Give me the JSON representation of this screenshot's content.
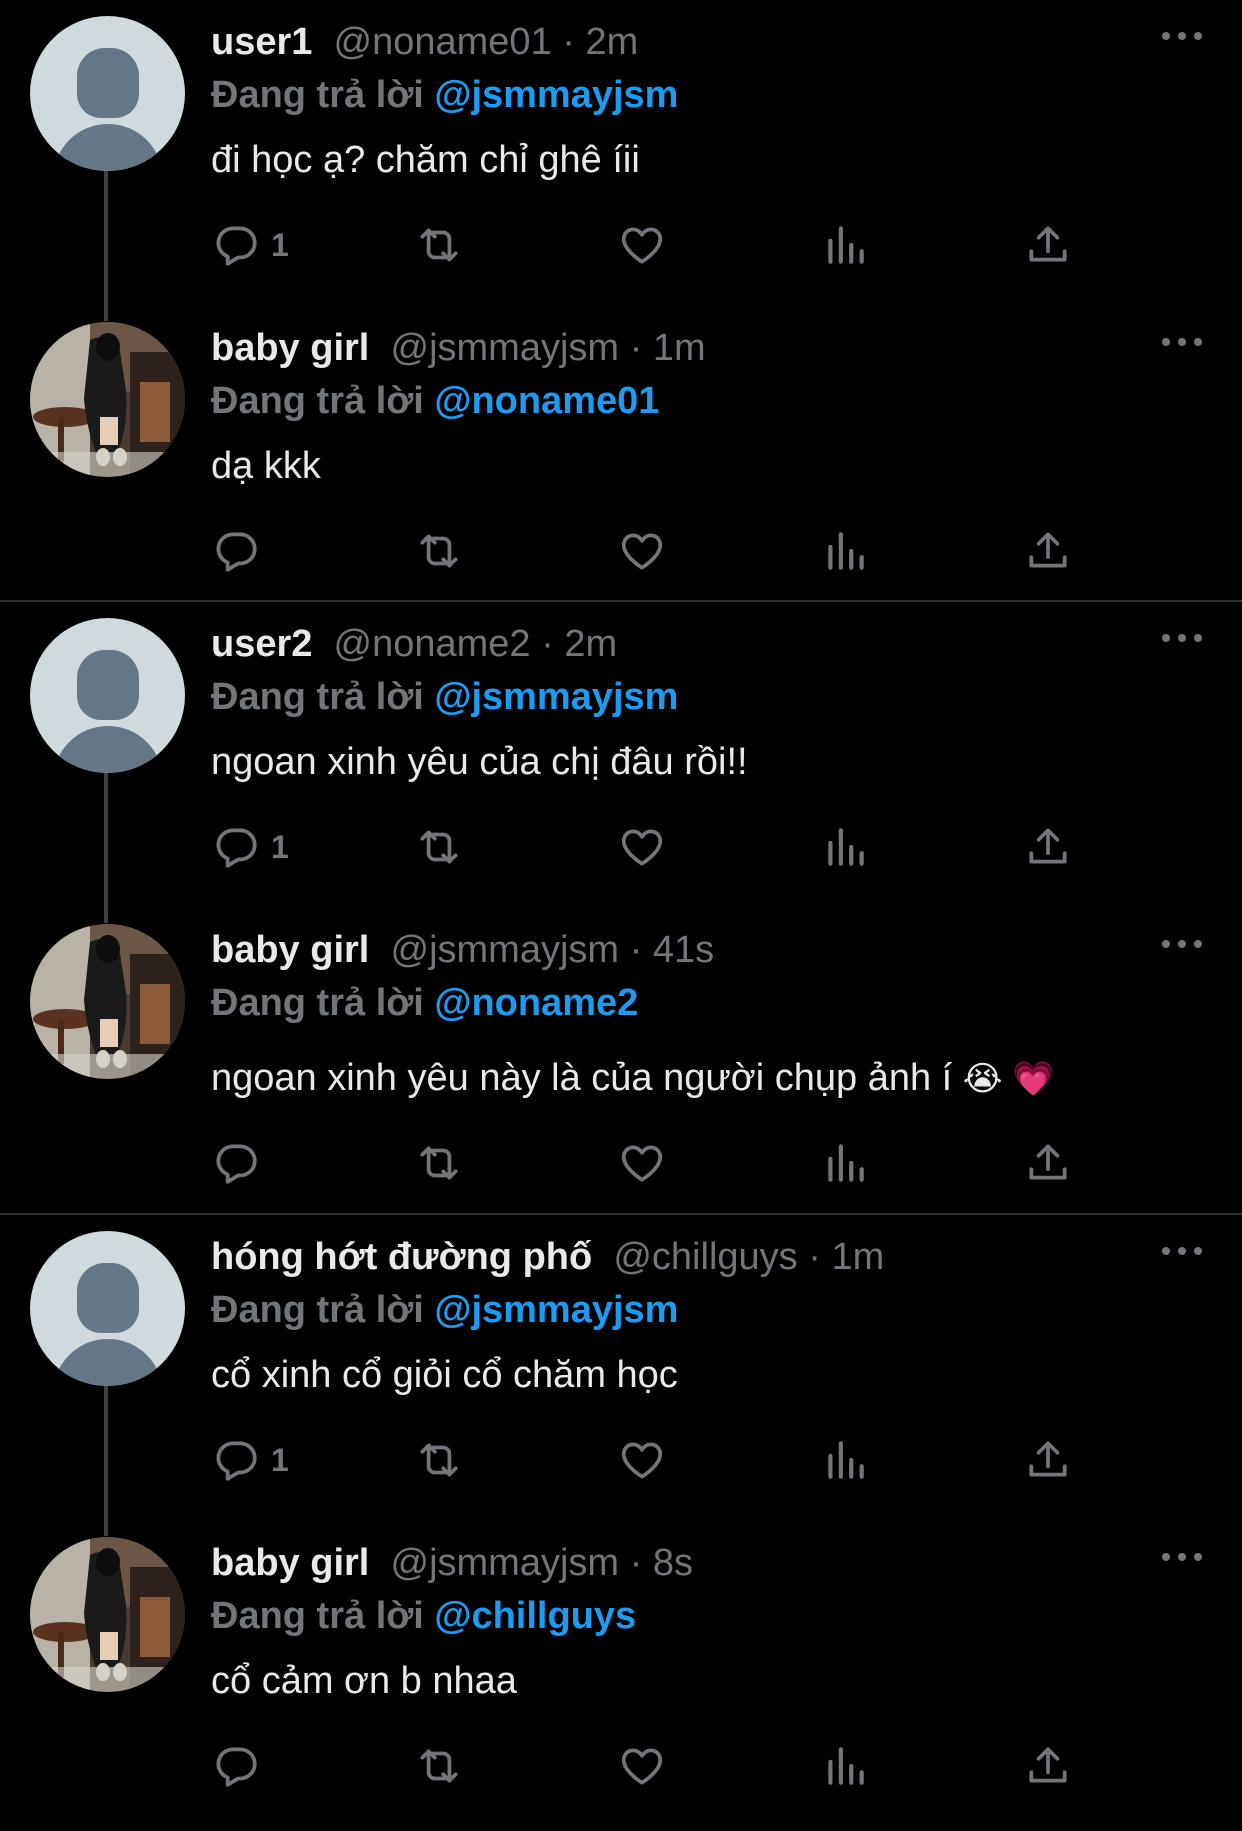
{
  "colors": {
    "background": "#000000",
    "text": "#e7e9ea",
    "muted": "#71767b",
    "mention": "#1d9bf0",
    "divider": "#2f3336"
  },
  "icons": {
    "reply": "reply-icon",
    "retweet": "retweet-icon",
    "like": "heart-icon",
    "views": "views-icon",
    "share": "share-icon",
    "more": "more-icon"
  },
  "threads": [
    {
      "reply": {
        "name": "user1",
        "handle": "@noname01",
        "sep": "·",
        "time": "2m",
        "replying_label": "Đang trả lời",
        "replying_to": "@jsmmayjsm",
        "text": "đi học ạ? chăm chỉ ghê íii",
        "reply_count": "1"
      },
      "answer": {
        "name": "baby girl",
        "handle": "@jsmmayjsm",
        "sep": "·",
        "time": "1m",
        "replying_label": "Đang trả lời",
        "replying_to": "@noname01",
        "text": "dạ kkk",
        "emoji": ""
      }
    },
    {
      "reply": {
        "name": "user2",
        "handle": "@noname2",
        "sep": "·",
        "time": "2m",
        "replying_label": "Đang trả lời",
        "replying_to": "@jsmmayjsm",
        "text": "ngoan xinh yêu của chị đâu rồi!!",
        "reply_count": "1"
      },
      "answer": {
        "name": "baby girl",
        "handle": "@jsmmayjsm",
        "sep": "·",
        "time": "41s",
        "replying_label": "Đang trả lời",
        "replying_to": "@noname2",
        "text": "ngoan xinh yêu này là của người chụp ảnh í",
        "emoji": "😭 💗"
      }
    },
    {
      "reply": {
        "name": "hóng hớt đường phố",
        "handle": "@chillguys",
        "sep": "·",
        "time": "1m",
        "replying_label": "Đang trả lời",
        "replying_to": "@jsmmayjsm",
        "text": "cổ xinh cổ giỏi cổ chăm học",
        "reply_count": "1"
      },
      "answer": {
        "name": "baby girl",
        "handle": "@jsmmayjsm",
        "sep": "·",
        "time": "8s",
        "replying_label": "Đang trả lời",
        "replying_to": "@chillguys",
        "text": "cổ cảm ơn b nhaa",
        "emoji": ""
      }
    }
  ]
}
